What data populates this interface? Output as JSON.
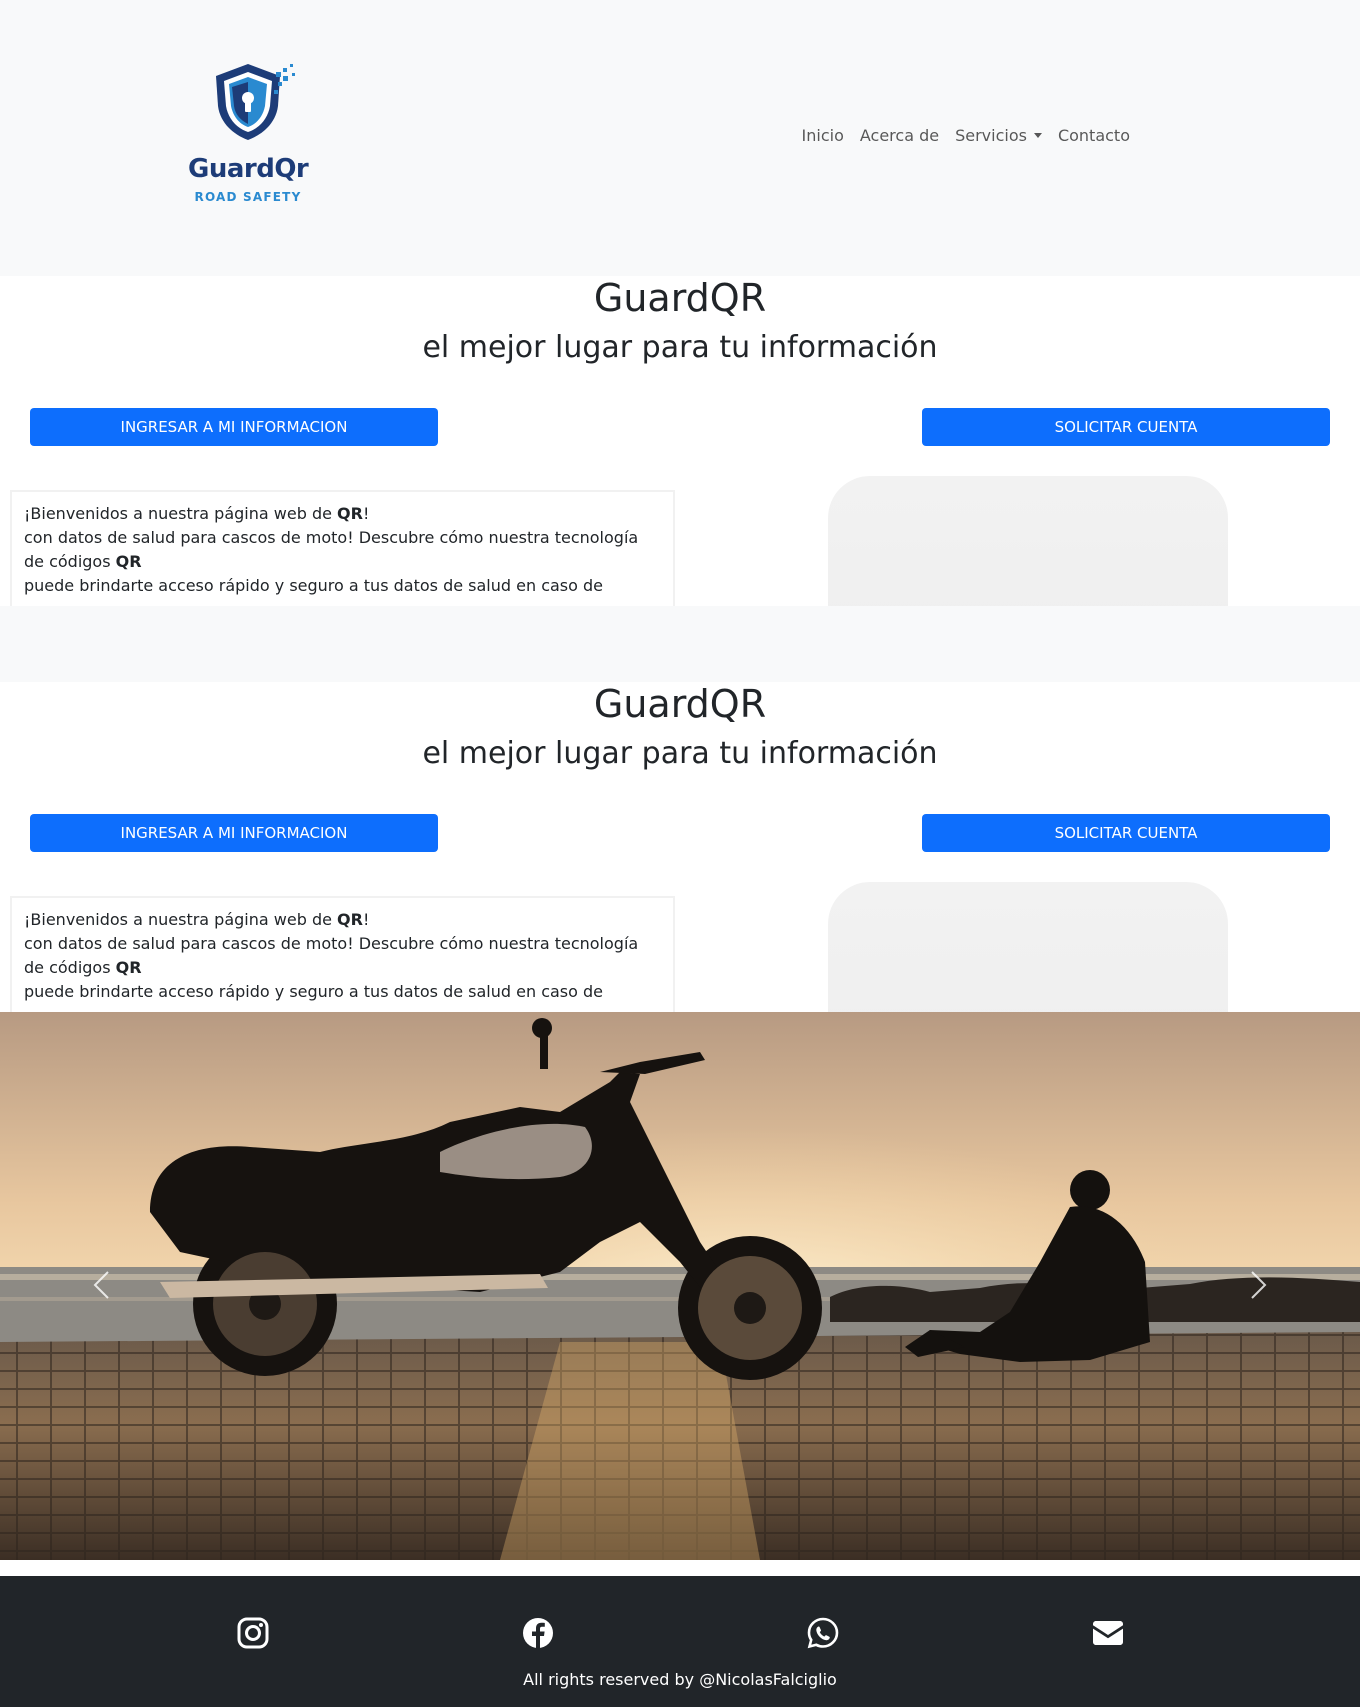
{
  "brand": {
    "name": "GuardQr",
    "tagline": "ROAD SAFETY",
    "color_primary": "#1d3c78",
    "color_accent": "#2a8ad0"
  },
  "nav": {
    "items": [
      {
        "label": "Inicio"
      },
      {
        "label": "Acerca de"
      },
      {
        "label": "Servicios",
        "has_dropdown": true
      },
      {
        "label": "Contacto"
      }
    ]
  },
  "hero": {
    "title": "GuardQR",
    "subtitle": "el mejor lugar para tu información",
    "login_button": "INGRESAR A MI INFORMACION",
    "signup_button": "SOLICITAR CUENTA",
    "button_color": "#0d6efd",
    "intro": {
      "p1_before": "¡Bienvenidos a nuestra página web de ",
      "p1_bold": "QR",
      "p1_after": "!",
      "p2": "con datos de salud para cascos de moto! Descubre cómo nuestra tecnología",
      "p3_before": "de códigos ",
      "p3_bold": "QR",
      "p4": "puede brindarte acceso rápido y seguro a tus datos de salud en caso de"
    }
  },
  "carousel": {
    "prev_icon": "chevron-left-icon",
    "next_icon": "chevron-right-icon"
  },
  "footer": {
    "icons": [
      "instagram-icon",
      "facebook-icon",
      "whatsapp-icon",
      "envelope-icon"
    ],
    "copyright": "All rights reserved by @NicolasFalciglio",
    "background": "#212529"
  }
}
